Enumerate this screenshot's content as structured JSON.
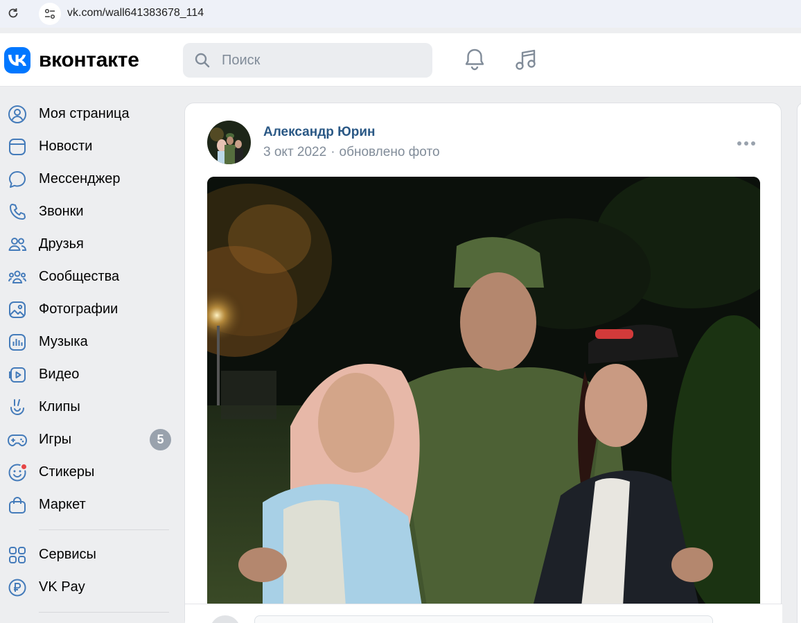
{
  "browser": {
    "url": "vk.com/wall641383678_114"
  },
  "header": {
    "logo_text": "вконтакте",
    "search_placeholder": "Поиск"
  },
  "sidebar": {
    "items": [
      {
        "label": "Моя страница",
        "icon": "profile-icon"
      },
      {
        "label": "Новости",
        "icon": "news-icon"
      },
      {
        "label": "Мессенджер",
        "icon": "messenger-icon"
      },
      {
        "label": "Звонки",
        "icon": "phone-icon"
      },
      {
        "label": "Друзья",
        "icon": "friends-icon"
      },
      {
        "label": "Сообщества",
        "icon": "communities-icon"
      },
      {
        "label": "Фотографии",
        "icon": "photos-icon"
      },
      {
        "label": "Музыка",
        "icon": "music-icon"
      },
      {
        "label": "Видео",
        "icon": "video-icon"
      },
      {
        "label": "Клипы",
        "icon": "clips-icon"
      },
      {
        "label": "Игры",
        "icon": "games-icon",
        "badge": "5"
      },
      {
        "label": "Стикеры",
        "icon": "stickers-icon"
      },
      {
        "label": "Маркет",
        "icon": "market-icon"
      }
    ],
    "extra_items": [
      {
        "label": "Сервисы",
        "icon": "services-icon"
      },
      {
        "label": "VK Pay",
        "icon": "vkpay-icon"
      }
    ]
  },
  "post": {
    "author": "Александр Юрин",
    "date": "3 окт 2022",
    "separator": "·",
    "action": "обновлено фото"
  },
  "colors": {
    "accent": "#0077ff",
    "link": "#2a5885",
    "icon": "#447bba",
    "muted": "#818c99"
  }
}
